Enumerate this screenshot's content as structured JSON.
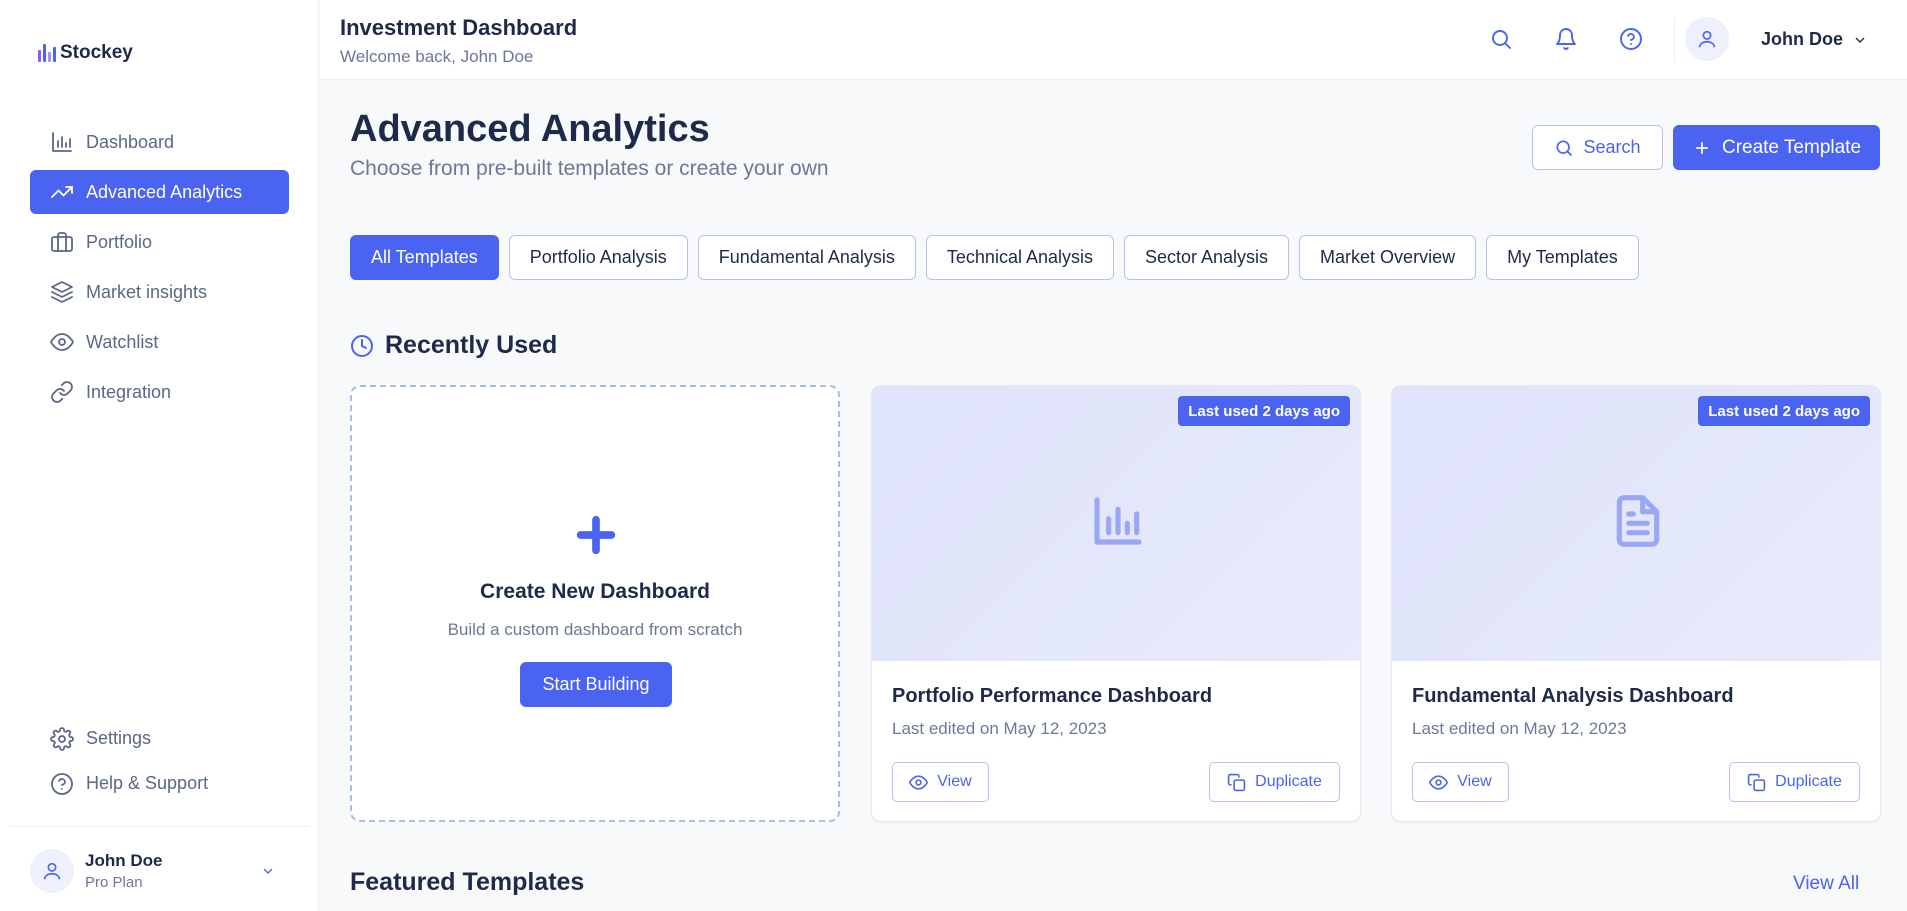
{
  "brand": {
    "name": "Stockey",
    "bar_colors": [
      "#8b5cf6",
      "#4a63f0",
      "#a78bfa",
      "#4a63f0"
    ]
  },
  "sidebar": {
    "items": [
      {
        "label": "Dashboard",
        "icon": "bar-chart-icon",
        "active": false
      },
      {
        "label": "Advanced Analytics",
        "icon": "trending-up-icon",
        "active": true
      },
      {
        "label": "Portfolio",
        "icon": "briefcase-icon",
        "active": false
      },
      {
        "label": "Market insights",
        "icon": "layers-icon",
        "active": false
      },
      {
        "label": "Watchlist",
        "icon": "eye-icon",
        "active": false
      },
      {
        "label": "Integration",
        "icon": "link-icon",
        "active": false
      }
    ],
    "bottom": [
      {
        "label": "Settings",
        "icon": "gear-icon"
      },
      {
        "label": "Help & Support",
        "icon": "help-circle-icon"
      }
    ],
    "user": {
      "name": "John Doe",
      "plan": "Pro Plan"
    }
  },
  "topbar": {
    "title": "Investment Dashboard",
    "subtitle": "Welcome back, John Doe",
    "user_name": "John Doe"
  },
  "main": {
    "title": "Advanced Analytics",
    "subtitle": "Choose from pre-built templates or create your own",
    "search_label": "Search",
    "create_label": "Create Template",
    "filters": [
      {
        "label": "All Templates",
        "active": true
      },
      {
        "label": "Portfolio Analysis",
        "active": false
      },
      {
        "label": "Fundamental Analysis",
        "active": false
      },
      {
        "label": "Technical Analysis",
        "active": false
      },
      {
        "label": "Sector Analysis",
        "active": false
      },
      {
        "label": "Market Overview",
        "active": false
      },
      {
        "label": "My Templates",
        "active": false
      }
    ],
    "recent_heading": "Recently Used",
    "new_card": {
      "title": "Create New Dashboard",
      "subtitle": "Build a custom dashboard from scratch",
      "button": "Start Building"
    },
    "cards": [
      {
        "badge": "Last used 2 days ago",
        "title": "Portfolio Performance Dashboard",
        "date": "Last edited on May 12, 2023",
        "view": "View",
        "duplicate": "Duplicate",
        "icon": "bar-chart-icon"
      },
      {
        "badge": "Last used 2 days ago",
        "title": "Fundamental Analysis Dashboard",
        "date": "Last edited on May 12, 2023",
        "view": "View",
        "duplicate": "Duplicate",
        "icon": "document-icon"
      }
    ],
    "featured_heading": "Featured Templates",
    "view_all": "View All"
  },
  "colors": {
    "accent": "#4a63f0",
    "text": "#1e2a4a",
    "muted": "#6d7896"
  }
}
